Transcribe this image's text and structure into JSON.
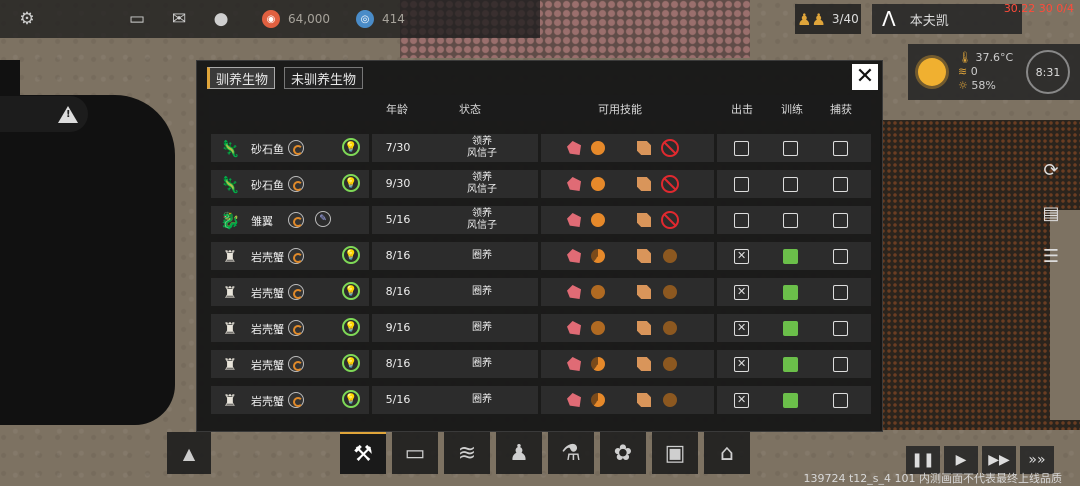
{
  "hud": {
    "food_value": "64,000",
    "research_value": "414",
    "population": "3/40",
    "player_name": "本夫凯",
    "time_readout": "30.22 30 0/4",
    "temperature": "37.6°C",
    "wind": "0",
    "humidity": "58%",
    "clock": "8:31"
  },
  "panel": {
    "tabs": [
      {
        "label": "驯养生物",
        "active": true
      },
      {
        "label": "未驯养生物",
        "active": false
      }
    ],
    "close_label": "✕",
    "headers": {
      "age": "年龄",
      "state": "状态",
      "skills": "可用技能",
      "sortie": "出击",
      "train": "训练",
      "capture": "捕获"
    },
    "rows": [
      {
        "name": "砂石鱼",
        "icon": "sandfish-icon",
        "age": "7/30",
        "state": "领养\n风信子",
        "extra": "bulb",
        "skills": [
          "pink",
          "orange",
          "scroll",
          "ban"
        ],
        "sortie": "empty",
        "train": "empty",
        "capture": "empty"
      },
      {
        "name": "砂石鱼",
        "icon": "sandfish-icon",
        "age": "9/30",
        "state": "领养\n风信子",
        "extra": "bulb",
        "skills": [
          "pink",
          "orange",
          "scroll",
          "ban"
        ],
        "sortie": "empty",
        "train": "empty",
        "capture": "empty"
      },
      {
        "name": "雏翼",
        "icon": "dragon-icon",
        "age": "5/16",
        "state": "领养\n风信子",
        "extra": "pen",
        "skills": [
          "pink",
          "orange",
          "scroll",
          "ban"
        ],
        "sortie": "empty",
        "train": "empty",
        "capture": "empty"
      },
      {
        "name": "岩壳蟹",
        "icon": "crab-icon",
        "age": "8/16",
        "state": "圈养",
        "extra": "bulb",
        "skills": [
          "pink",
          "half",
          "scroll",
          "dot"
        ],
        "sortie": "x",
        "train": "green",
        "capture": "empty"
      },
      {
        "name": "岩壳蟹",
        "icon": "crab-icon",
        "age": "8/16",
        "state": "圈养",
        "extra": "bulb",
        "skills": [
          "pink",
          "dim",
          "scroll",
          "dot"
        ],
        "sortie": "x",
        "train": "green",
        "capture": "empty"
      },
      {
        "name": "岩壳蟹",
        "icon": "crab-icon",
        "age": "9/16",
        "state": "圈养",
        "extra": "bulb",
        "skills": [
          "pink",
          "dim",
          "scroll",
          "dot"
        ],
        "sortie": "x",
        "train": "green",
        "capture": "empty"
      },
      {
        "name": "岩壳蟹",
        "icon": "crab-icon",
        "age": "8/16",
        "state": "圈养",
        "extra": "bulb",
        "skills": [
          "pink",
          "half",
          "scroll",
          "dot"
        ],
        "sortie": "x",
        "train": "green",
        "capture": "empty"
      },
      {
        "name": "岩壳蟹",
        "icon": "crab-icon",
        "age": "5/16",
        "state": "圈养",
        "extra": "bulb",
        "skills": [
          "pink",
          "half",
          "scroll",
          "dot"
        ],
        "sortie": "x",
        "train": "green",
        "capture": "empty"
      }
    ]
  },
  "toolbar": {
    "items": [
      "build-icon",
      "storage-icon",
      "audio-icon",
      "people-icon",
      "science-icon",
      "creature-icon",
      "chat-icon",
      "building-icon"
    ]
  },
  "footer": "139724 t12_s_4 101  内测画面不代表最终上线品质",
  "colors": {
    "accent": "#e0a53a",
    "train_on": "#6bbf4a",
    "bulb": "#7ed957",
    "ban": "#e0292f",
    "time": "#ff4b3a"
  }
}
